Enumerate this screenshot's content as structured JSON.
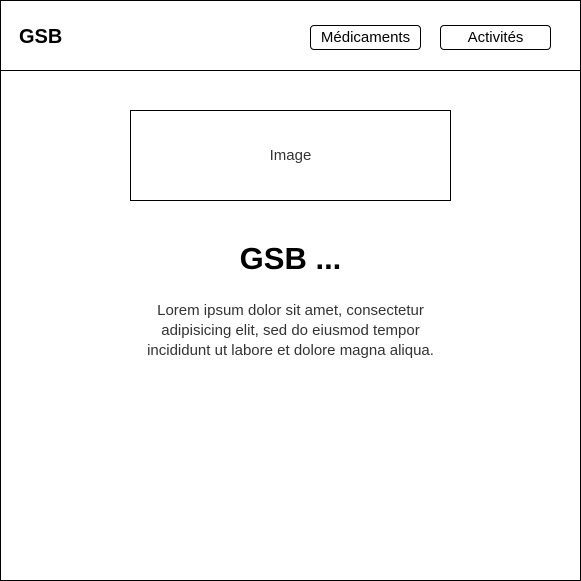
{
  "header": {
    "logo": "GSB",
    "nav": {
      "medicaments_label": "Médicaments",
      "activites_label": "Activités"
    }
  },
  "main": {
    "image_placeholder": "Image",
    "title": "GSB ...",
    "description": "Lorem ipsum dolor sit amet, consectetur adipisicing elit, sed do eiusmod tempor incididunt ut labore et dolore magna aliqua."
  },
  "colors": {
    "border": "#000000",
    "background": "#ffffff",
    "body_text": "#333333"
  }
}
